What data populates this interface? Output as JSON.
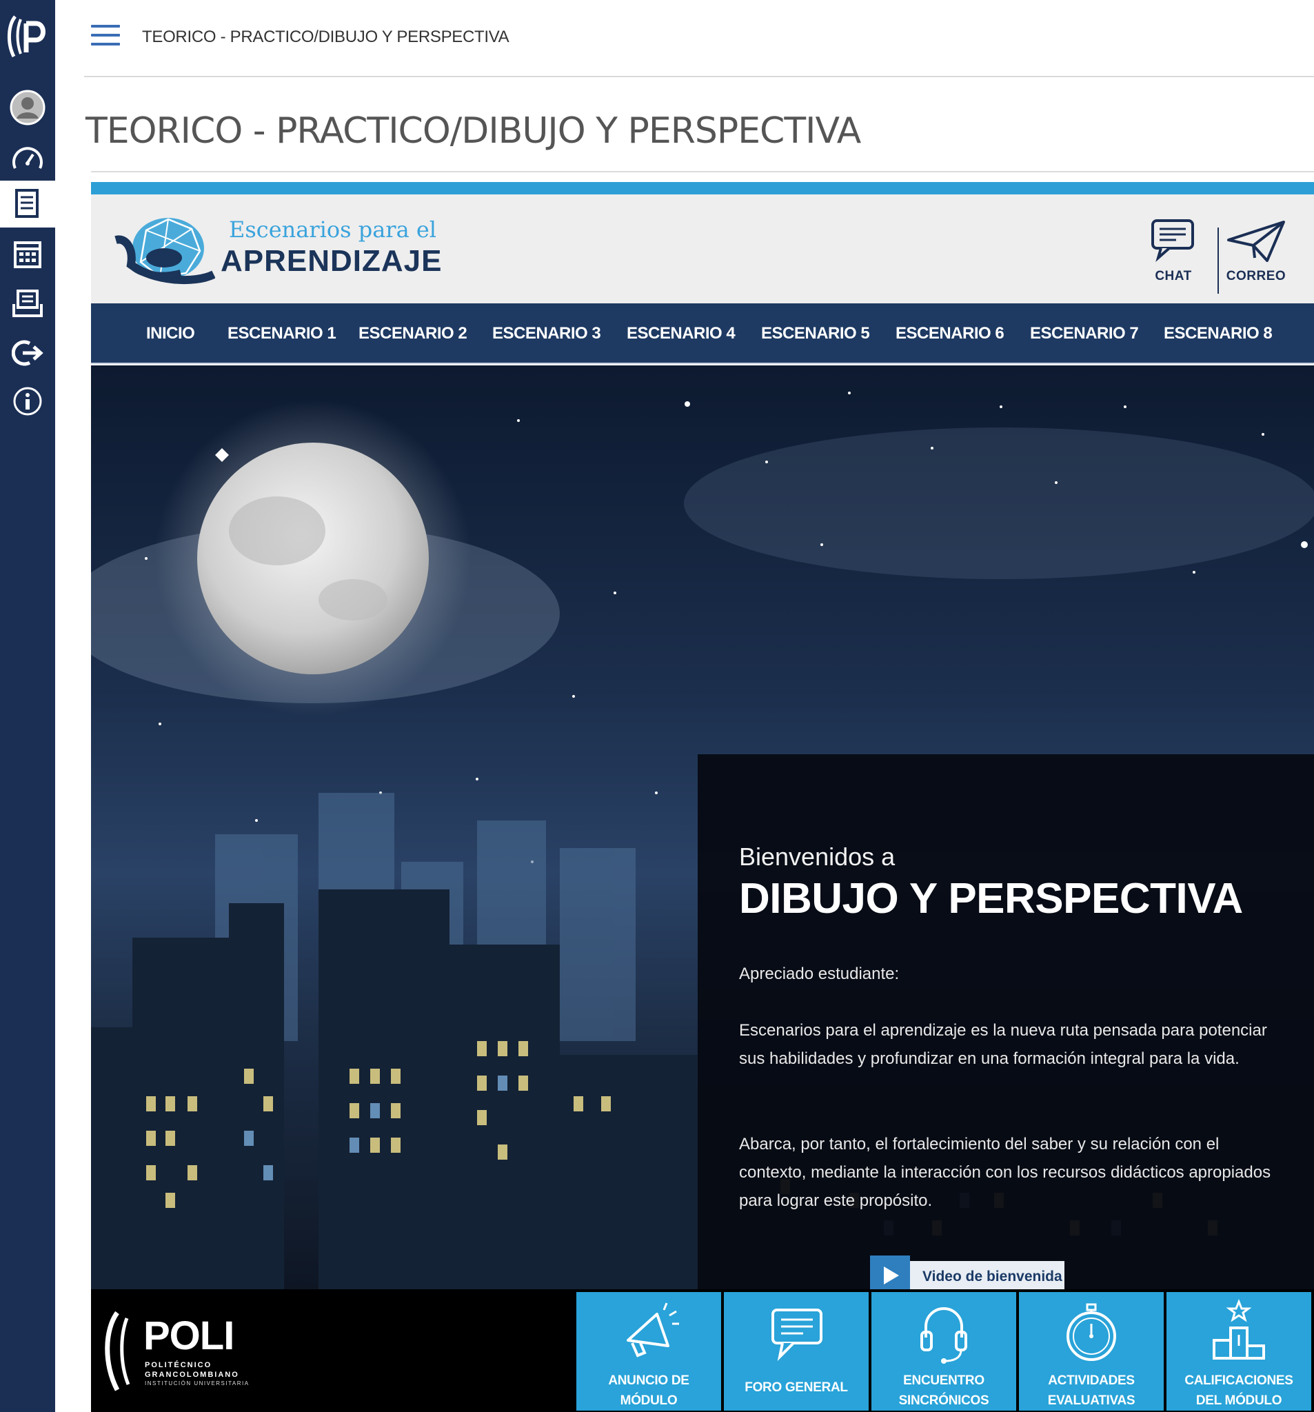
{
  "breadcrumb": "TEORICO - PRACTICO/DIBUJO Y PERSPECTIVA",
  "page_title": "TEORICO - PRACTICO/DIBUJO Y PERSPECTIVA",
  "sidebar": {
    "items": [
      {
        "icon": "user-avatar-icon"
      },
      {
        "icon": "dashboard-icon"
      },
      {
        "icon": "courses-icon",
        "active": true
      },
      {
        "icon": "calendar-icon"
      },
      {
        "icon": "inbox-icon"
      },
      {
        "icon": "logout-icon"
      },
      {
        "icon": "info-icon"
      }
    ]
  },
  "brand": {
    "line1": "Escenarios para el",
    "line2": "APRENDIZAJE"
  },
  "tools": {
    "chat": "CHAT",
    "mail": "CORREO"
  },
  "menu": [
    "INICIO",
    "ESCENARIO 1",
    "ESCENARIO 2",
    "ESCENARIO 3",
    "ESCENARIO 4",
    "ESCENARIO 5",
    "ESCENARIO 6",
    "ESCENARIO 7",
    "ESCENARIO 8"
  ],
  "welcome": {
    "small": "Bienvenidos a",
    "big": "DIBUJO Y PERSPECTIVA",
    "greeting": "Apreciado estudiante:",
    "p1": "Escenarios para el aprendizaje es la nueva ruta pensada para potenciar sus habilidades y profundizar en una formación integral para la vida.",
    "p2": "Abarca, por tanto, el fortalecimiento del saber y su relación con el contexto, mediante la interacción con los recursos didácticos apropiados para lograr este propósito.",
    "video_label": "Video de bienvenida"
  },
  "footer": {
    "logo_name": "POLI",
    "logo_sub1": "POLITÉCNICO",
    "logo_sub2": "GRANCOLOMBIANO",
    "logo_sub3": "INSTITUCIÓN UNIVERSITARIA",
    "buttons": [
      {
        "icon": "megaphone-icon",
        "line1": "ANUNCIO DE",
        "line2": "MÓDULO"
      },
      {
        "icon": "forum-icon",
        "line1": "FORO GENERAL",
        "line2": ""
      },
      {
        "icon": "headset-icon",
        "line1": "ENCUENTRO",
        "line2": "SINCRÓNICOS"
      },
      {
        "icon": "stopwatch-icon",
        "line1": "ACTIVIDADES",
        "line2": "EVALUATIVAS"
      },
      {
        "icon": "podium-icon",
        "line1": "CALIFICACIONES",
        "line2": "DEL MÓDULO"
      }
    ]
  },
  "colors": {
    "rail": "#1b2f55",
    "accent": "#2d9fd6",
    "menubar": "#1e3a63",
    "footer_button": "#29a3d9"
  }
}
